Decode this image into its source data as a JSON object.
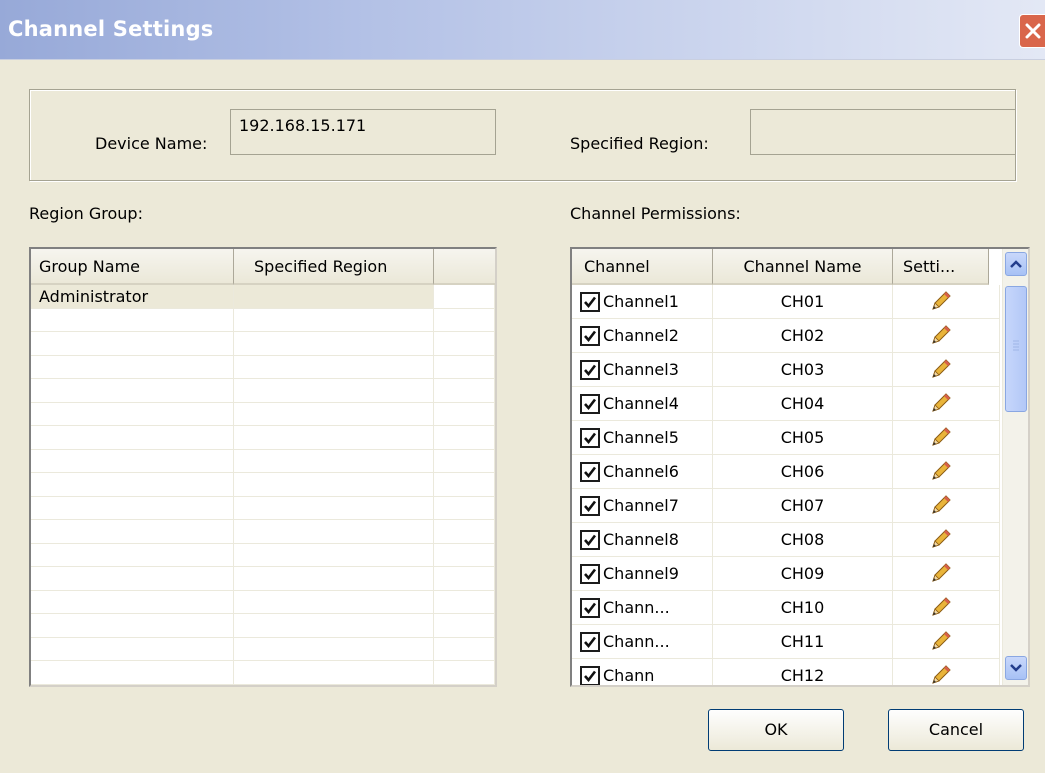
{
  "window": {
    "title": "Channel Settings"
  },
  "device": {
    "name_label": "Device Name:",
    "name_value": "192.168.15.171",
    "region_label": "Specified Region:",
    "region_value": ""
  },
  "region_group": {
    "label": "Region Group:",
    "columns": [
      "Group Name",
      "Specified Region"
    ],
    "rows": [
      {
        "group": "Administrator",
        "region": ""
      }
    ]
  },
  "channel_permissions": {
    "label": "Channel Permissions:",
    "columns": [
      "Channel",
      "Channel Name",
      "Setti..."
    ],
    "rows": [
      {
        "channel": "Channel1",
        "name": "CH01",
        "checked": true
      },
      {
        "channel": "Channel2",
        "name": "CH02",
        "checked": true
      },
      {
        "channel": "Channel3",
        "name": "CH03",
        "checked": true
      },
      {
        "channel": "Channel4",
        "name": "CH04",
        "checked": true
      },
      {
        "channel": "Channel5",
        "name": "CH05",
        "checked": true
      },
      {
        "channel": "Channel6",
        "name": "CH06",
        "checked": true
      },
      {
        "channel": "Channel7",
        "name": "CH07",
        "checked": true
      },
      {
        "channel": "Channel8",
        "name": "CH08",
        "checked": true
      },
      {
        "channel": "Channel9",
        "name": "CH09",
        "checked": true
      },
      {
        "channel": "Chann...",
        "name": "CH10",
        "checked": true
      },
      {
        "channel": "Chann...",
        "name": "CH11",
        "checked": true
      },
      {
        "channel": "Chann",
        "name": "CH12",
        "checked": true
      }
    ],
    "settings_icon": "pencil-icon"
  },
  "buttons": {
    "ok": "OK",
    "cancel": "Cancel"
  },
  "colors": {
    "titlebar_start": "#97a9d8",
    "close_button": "#d9664b",
    "dialog_bg": "#ece9d8"
  }
}
